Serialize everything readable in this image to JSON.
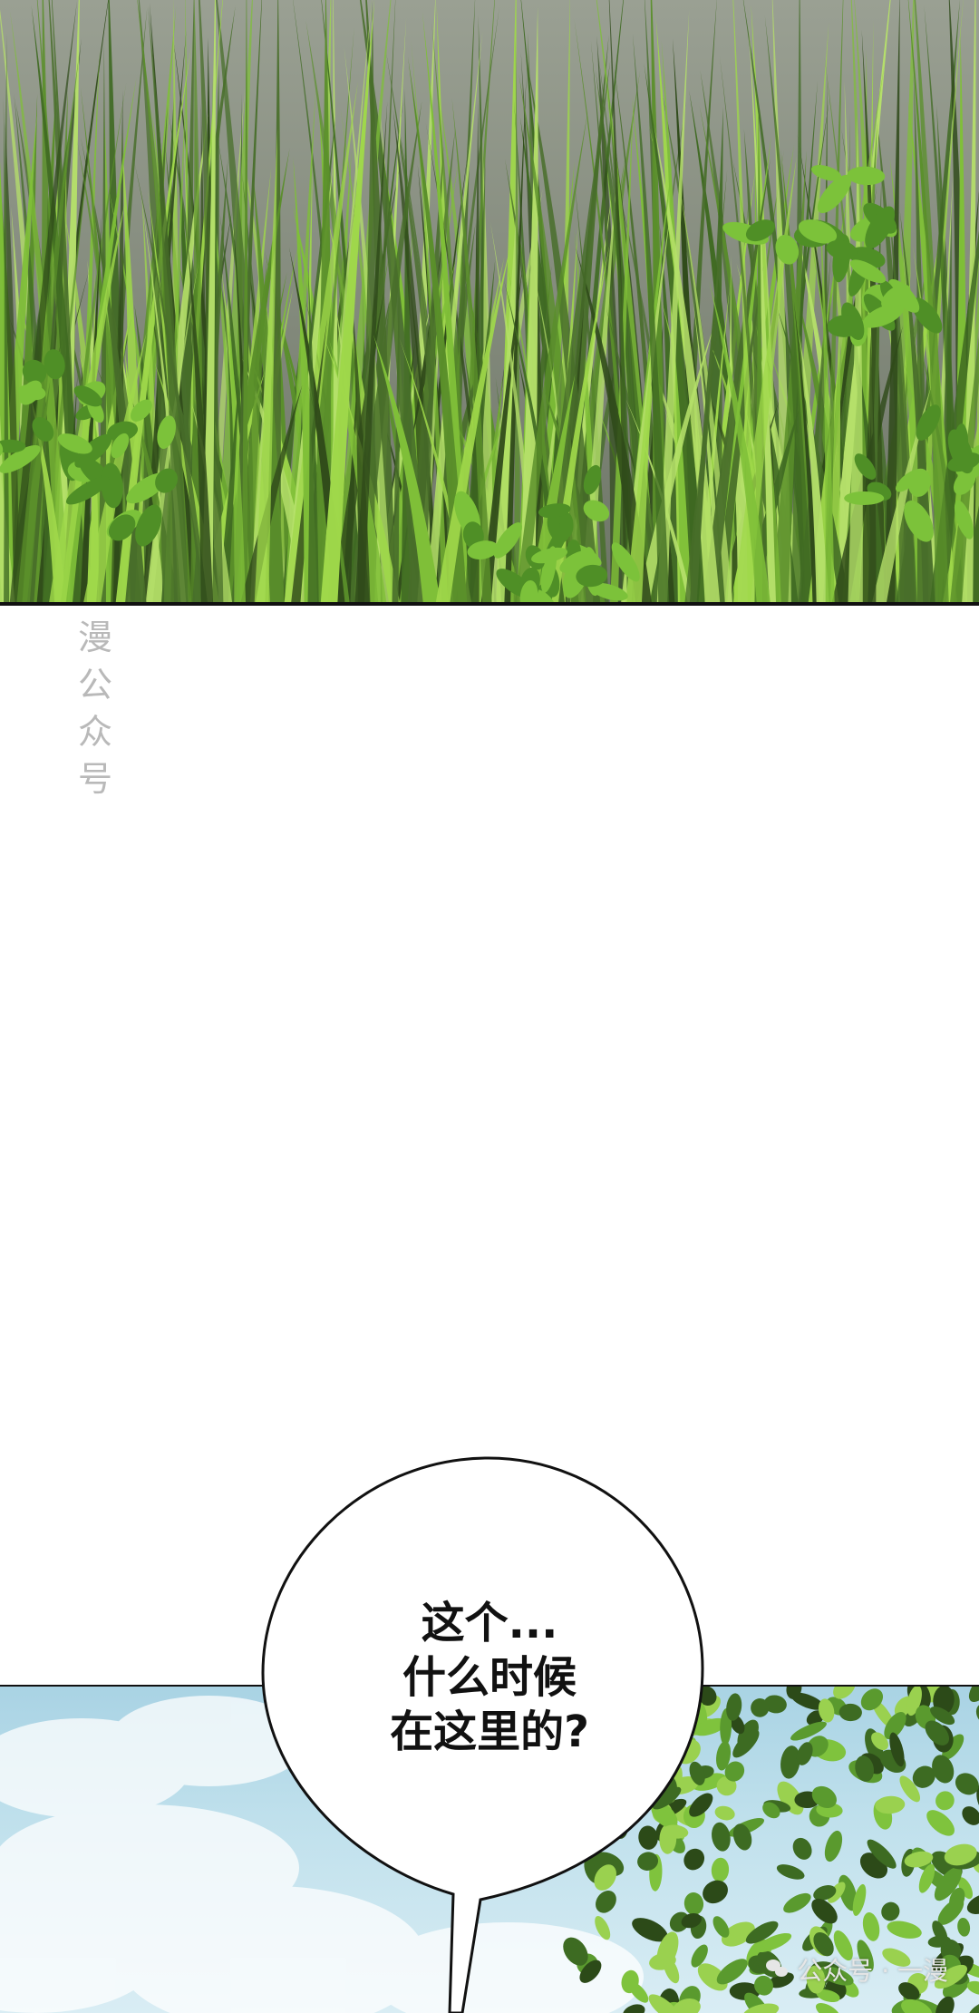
{
  "watermark_vertical": [
    "漫",
    "公",
    "众",
    "号"
  ],
  "speech_bubble": {
    "lines": [
      "这个...",
      "什么时候",
      "在这里的?"
    ]
  },
  "watermark_corner": {
    "icon": "wechat-icon",
    "text": "公众号 · 一漫"
  },
  "colors": {
    "grass_dark": "#2f4a1a",
    "grass_light": "#8fcf3f",
    "sky": "#a9d3e4",
    "tree_green": "#4f8a2a"
  }
}
